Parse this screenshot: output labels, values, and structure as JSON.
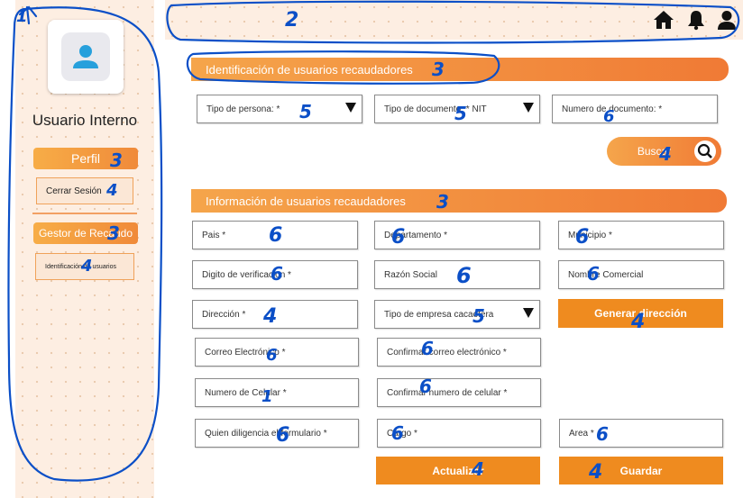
{
  "sidebar": {
    "title": "Usuario Interno",
    "perfil_label": "Perfil",
    "cerrar_label": "Cerrar Sesión",
    "gestor_label": "Gestor de Recaudo",
    "identificacion_label": "Identificación de usuarios"
  },
  "header": {
    "icons": [
      "home-icon",
      "bell-icon",
      "user-icon"
    ]
  },
  "section1": {
    "title": "Identificación de usuarios recaudadores",
    "tipo_persona": "Tipo de persona: *",
    "tipo_documento": "Tipo de documento: * NIT",
    "numero_documento": "Numero de documento: *",
    "buscar_label": "Buscar"
  },
  "section2": {
    "title": "Información de usuarios recaudadores",
    "pais": "Pais *",
    "departamento": "Departamento *",
    "municipio": "Municipio *",
    "digito": "Digito de verificacion *",
    "razon_social": "Razón Social",
    "nombre_comercial": "Nombre Comercial",
    "direccion": "Dirección *",
    "tipo_empresa": "Tipo de empresa cacaotera",
    "generar_direccion": "Generar dirección",
    "correo": "Correo Electrónico *",
    "confirmar_correo": "Confirmar correo electrónico *",
    "numero_celular": "Numero de Celular *",
    "confirmar_celular": "Confirmar numero de celular *",
    "quien_diligencia": "Quien diligencia el formulario *",
    "cargo": "Cargo *",
    "area": "Area *",
    "actualizar": "Actualizar",
    "guardar": "Guardar"
  },
  "annotations": {
    "n1": "1",
    "n2": "2",
    "n3a": "3",
    "n3b": "3",
    "n3c": "3",
    "n3d": "3",
    "n4a": "4",
    "n4b": "4",
    "n4c": "4",
    "n4d": "4",
    "n4e": "4",
    "n4f": "4",
    "n5a": "5",
    "n5b": "5",
    "n5c": "5",
    "n6a": "6",
    "n6b": "6",
    "n6c": "6",
    "n6d": "6",
    "n6e": "6",
    "n6f": "6",
    "n6g": "6",
    "n6h": "6",
    "n6i": "6",
    "n6j": "6",
    "n6k": "6",
    "n6l": "6",
    "n6m": "6",
    "n1b": "1",
    "n4g": "4"
  },
  "colors": {
    "accent": "#ef8b1f",
    "gradient_start": "#f5a54b",
    "gradient_end": "#f07a35",
    "sidebar_bg": "#fdeee2",
    "annotation_ink": "#0b4fc7"
  }
}
